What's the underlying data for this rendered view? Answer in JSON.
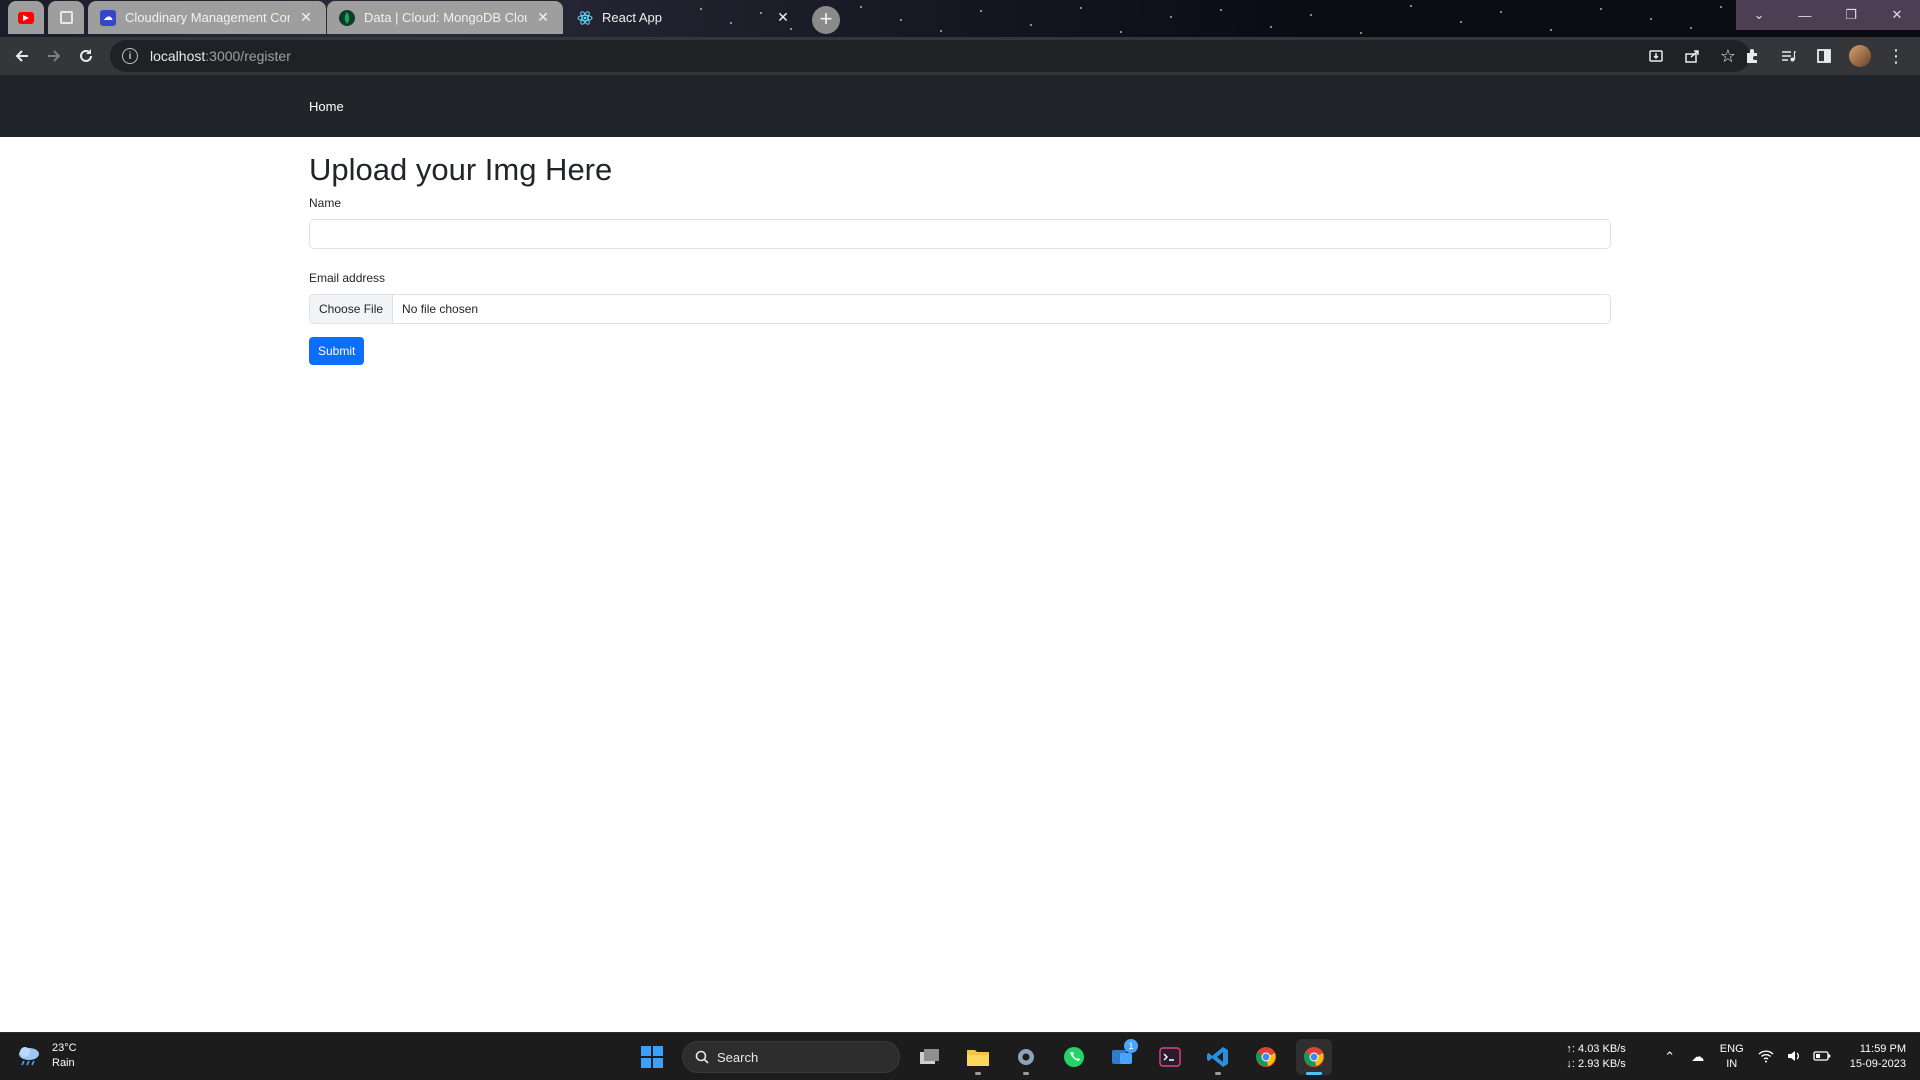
{
  "browser": {
    "tabs": [
      {
        "label": "",
        "icon": "youtube-icon",
        "pinned": true
      },
      {
        "label": "",
        "icon": "page-icon",
        "pinned": true
      },
      {
        "label": "Cloudinary Management Conso",
        "icon": "cloudinary-icon"
      },
      {
        "label": "Data | Cloud: MongoDB Cloud",
        "icon": "mongodb-leaf-icon"
      },
      {
        "label": "React App",
        "icon": "react-icon",
        "active": true
      }
    ],
    "address_host": "localhost",
    "address_path": ":3000/register"
  },
  "navbar": {
    "home_label": "Home"
  },
  "form": {
    "title": "Upload your Img Here",
    "name_label": "Name",
    "name_value": "",
    "email_label": "Email address",
    "file_button_label": "Choose File",
    "file_status": "No file chosen",
    "submit_label": "Submit"
  },
  "colors": {
    "navbar_bg": "#212529",
    "primary": "#0d6efd",
    "toolbar_bg": "#35363a"
  },
  "taskbar": {
    "weather_temp": "23°C",
    "weather_desc": "Rain",
    "search_label": "Search",
    "network_up": "↑: 4.03 KB/s",
    "network_down": "↓: 2.93 KB/s",
    "lang_primary": "ENG",
    "lang_region": "IN",
    "time": "11:59 PM",
    "date": "15-09-2023",
    "teams_badge": "1"
  }
}
